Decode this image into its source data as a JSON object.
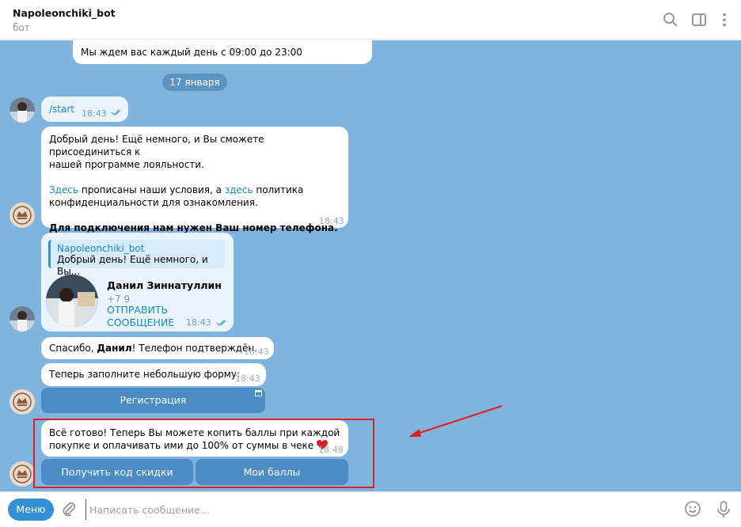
{
  "header": {
    "title": "Napoleonchiki_bot",
    "subtitle": "бот"
  },
  "chat": {
    "top_message": "Мы ждем вас каждый день с 09:00 до 23:00",
    "date_separator": "17 января",
    "start": {
      "text": "/start",
      "time": "18:43"
    },
    "greeting": {
      "line1": "Добрый день! Ещё немного, и Вы сможете присоединиться к",
      "line2": "нашей программе лояльности.",
      "link1": "Здесь",
      "mid1": " прописаны наши условия, а ",
      "link2": "здесь",
      "mid2": " политика",
      "line4": "конфиденциальности для ознакомления.",
      "bold_line": "Для подключения нам нужен Ваш номер телефона.",
      "time": "18:43"
    },
    "contact": {
      "reply_name": "Napoleonchiki_bot",
      "reply_text": "Добрый день! Ещё немного, и Вы...",
      "name": "Данил Зиннатуллин",
      "phone": "+7 9",
      "action": "ОТПРАВИТЬ СООБЩЕНИЕ",
      "time": "18:43"
    },
    "thanks": {
      "pre": "Спасибо, ",
      "name": "Данил",
      "post": "! Телефон подтверждён.",
      "time": "18:43"
    },
    "form": {
      "text": "Теперь заполните небольшую форму:",
      "time": "18:43",
      "button": "Регистрация"
    },
    "done": {
      "line1": "Всё готово! Теперь Вы можете копить баллы при каждой",
      "line2": "покупке и оплачивать ими до 100% от суммы в чеке",
      "time": "18:48",
      "button1": "Получить код скидки",
      "button2": "Мои баллы"
    }
  },
  "composer": {
    "menu": "Меню",
    "placeholder": "Написать сообщение..."
  },
  "colors": {
    "chat_bg": "#7fb4df",
    "accent": "#3390d6",
    "annotation": "#e01f1f"
  }
}
